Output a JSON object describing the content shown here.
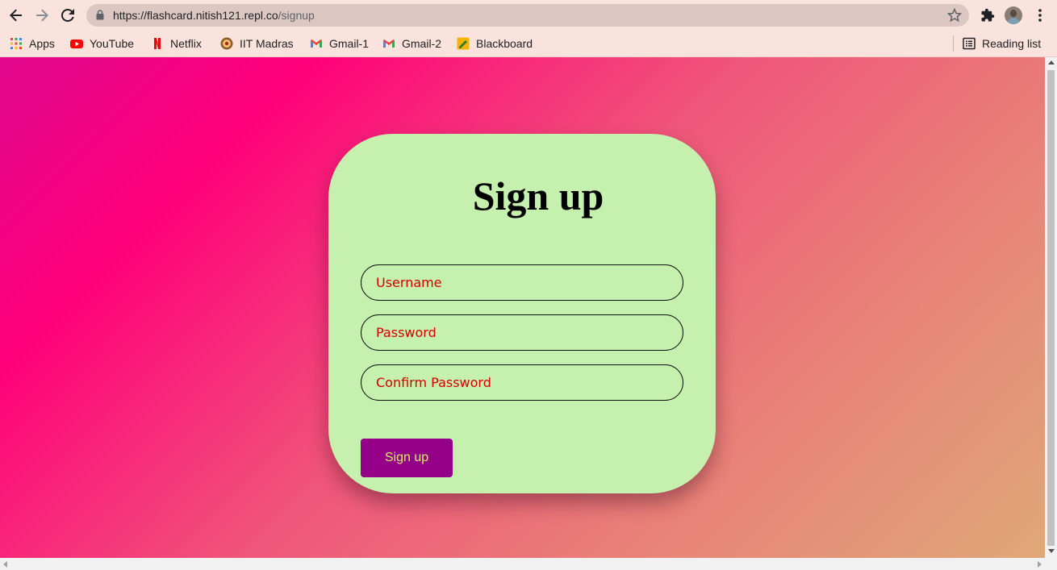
{
  "browser": {
    "url_host": "https://flashcard.nitish121.repl.co",
    "url_path": "/signup",
    "bookmarks": [
      {
        "label": "Apps",
        "icon": "apps-grid-icon"
      },
      {
        "label": "YouTube",
        "icon": "youtube-icon"
      },
      {
        "label": "Netflix",
        "icon": "netflix-icon"
      },
      {
        "label": "IIT Madras",
        "icon": "iit-madras-icon"
      },
      {
        "label": "Gmail-1",
        "icon": "gmail-icon"
      },
      {
        "label": "Gmail-2",
        "icon": "gmail-icon"
      },
      {
        "label": "Blackboard",
        "icon": "blackboard-icon"
      }
    ],
    "reading_list": "Reading list"
  },
  "form": {
    "title": "Sign up",
    "username_placeholder": "Username",
    "password_placeholder": "Password",
    "confirm_placeholder": "Confirm Password",
    "submit_label": "Sign up"
  },
  "colors": {
    "card_bg": "#c5f0ad",
    "button_bg": "#950089",
    "button_text": "#d8f05a",
    "placeholder_text": "#d40000"
  }
}
